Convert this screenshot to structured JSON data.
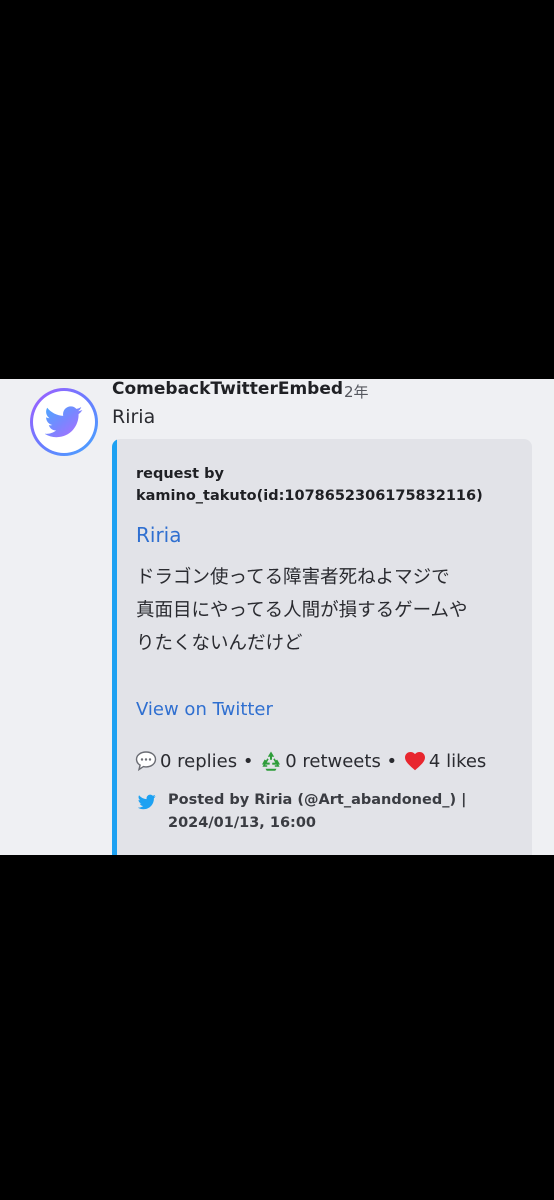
{
  "colors": {
    "background": "#000000",
    "panel": "#eff0f3",
    "embed_background": "#e2e3e8",
    "embed_accent": "#1da1f2",
    "link": "#2f6fd0"
  },
  "message": {
    "author": "ComebackTwitterEmbed",
    "timestamp": "2年",
    "text": "Riria",
    "avatar_icon": "twitter-bird-icon"
  },
  "embed": {
    "header_line1": "request by",
    "header_line2": "kamino_takuto(id:1078652306175832116)",
    "title": "Riria",
    "description_lines": [
      "ドラゴン使ってる障害者死ねよマジで",
      "真面目にやってる人間が損するゲームや",
      "りたくないんだけど"
    ],
    "view_link": "View on Twitter",
    "stats": {
      "replies": "0 replies",
      "separator": " • ",
      "retweets": "0 retweets",
      "likes": "4 likes"
    },
    "footer_line1": "Posted by Riria (@Art_abandoned_) |",
    "footer_line2": "2024/01/13, 16:00",
    "footer_icon": "twitter-bird-icon"
  }
}
